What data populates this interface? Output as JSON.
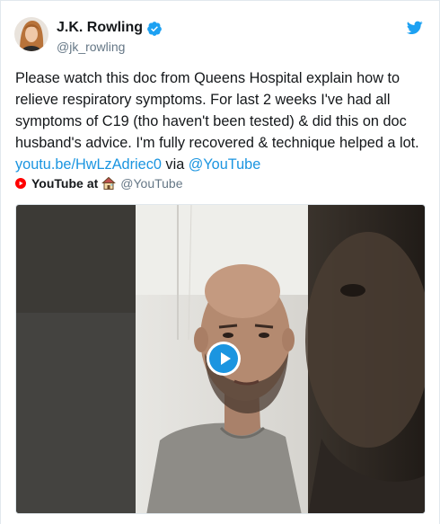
{
  "author": {
    "display_name": "J.K. Rowling",
    "handle": "@jk_rowling",
    "verified": true
  },
  "tweet": {
    "text_before": "Please watch this doc from Queens Hospital explain how to relieve respiratory symptoms. For last 2 weeks I've had all symptoms of C19 (tho haven't been tested) & did this on doc husband's advice. I'm fully recovered & technique helped a lot. ",
    "link": "youtu.be/HwLzAdriec0",
    "via": " via ",
    "mention": "@YouTube"
  },
  "source": {
    "name": "YouTube",
    "at": "at",
    "handle": "@YouTube"
  },
  "video": {
    "play_state": "paused"
  },
  "colors": {
    "link": "#1b95e0",
    "twitter_blue": "#1da1f2",
    "youtube_red": "#ff0000",
    "secondary_text": "#657786"
  },
  "icons": [
    "twitter-bird-icon",
    "verified-badge-icon",
    "youtube-icon",
    "house-icon",
    "play-icon"
  ]
}
